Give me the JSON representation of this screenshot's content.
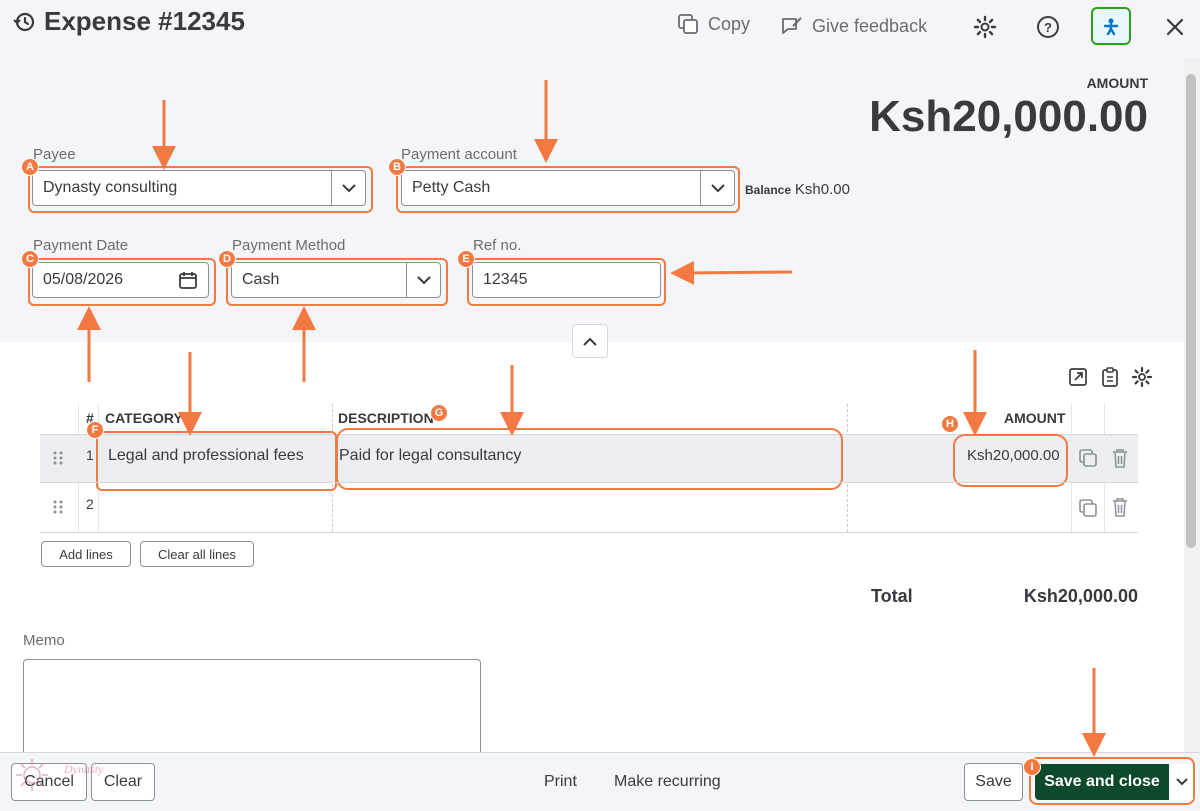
{
  "header": {
    "title": "Expense #12345",
    "copy_label": "Copy",
    "feedback_label": "Give feedback"
  },
  "amount": {
    "label": "AMOUNT",
    "value": "Ksh20,000.00"
  },
  "form": {
    "payee": {
      "label": "Payee",
      "value": "Dynasty consulting",
      "badge": "A"
    },
    "payment_account": {
      "label": "Payment account",
      "value": "Petty Cash",
      "badge": "B"
    },
    "balance": {
      "label": "Balance",
      "value": "Ksh0.00"
    },
    "payment_date": {
      "label": "Payment Date",
      "value": "05/08/2026",
      "badge": "C"
    },
    "payment_method": {
      "label": "Payment Method",
      "value": "Cash",
      "badge": "D"
    },
    "ref_no": {
      "label": "Ref no.",
      "value": "12345",
      "badge": "E"
    }
  },
  "table": {
    "headers": {
      "num": "#",
      "category": "CATEGORY",
      "description": "DESCRIPTION",
      "amount": "AMOUNT"
    },
    "badges": {
      "category": "F",
      "description": "G",
      "amount": "H"
    },
    "rows": [
      {
        "num": "1",
        "category": "Legal and professional fees",
        "description": "Paid for legal consultancy",
        "amount": "Ksh20,000.00"
      },
      {
        "num": "2",
        "category": "",
        "description": "",
        "amount": ""
      }
    ],
    "add_lines": "Add lines",
    "clear_all_lines": "Clear all lines"
  },
  "total": {
    "label": "Total",
    "value": "Ksh20,000.00"
  },
  "memo": {
    "label": "Memo"
  },
  "footer": {
    "cancel": "Cancel",
    "clear": "Clear",
    "print": "Print",
    "make_recurring": "Make recurring",
    "save": "Save",
    "save_and_close": "Save and close",
    "badge": "I",
    "watermark": "Dynasty"
  },
  "colors": {
    "annotation": "#f27a42",
    "primary_button": "#0c4a2b",
    "panel_bg": "#f4f5f8"
  }
}
